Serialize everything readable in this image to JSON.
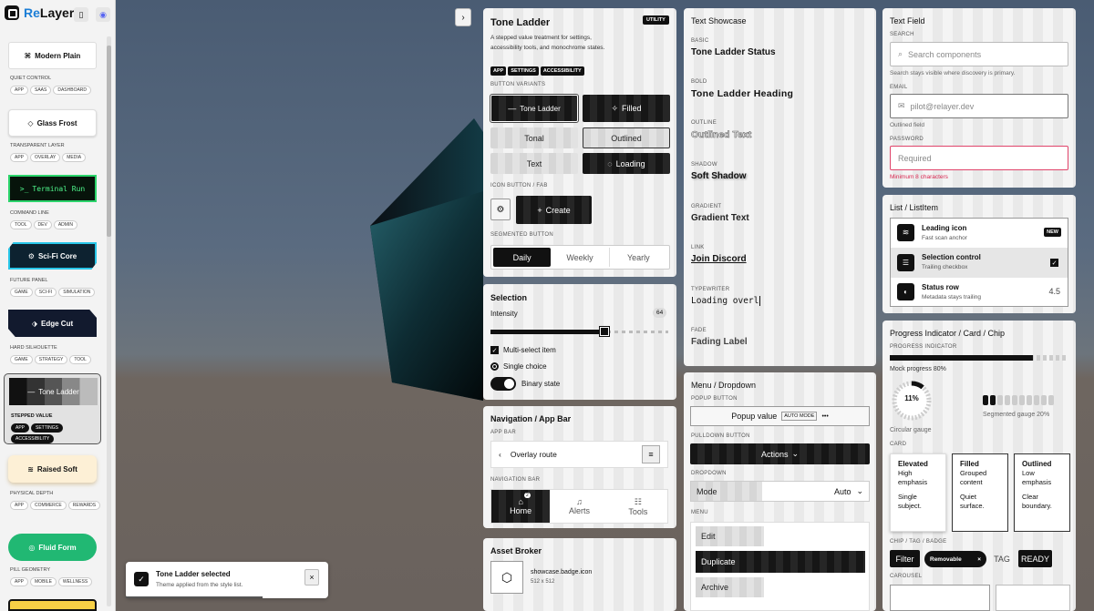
{
  "app": {
    "brand_re": "Re",
    "brand_layer": "Layer"
  },
  "sidebar": {
    "cards": [
      {
        "label": "Modern Plain",
        "caption": "QUIET CONTROL",
        "tags": [
          "APP",
          "SAAS",
          "DASHBOARD"
        ]
      },
      {
        "label": "Glass Frost",
        "caption": "TRANSPARENT LAYER",
        "tags": [
          "APP",
          "OVERLAY",
          "MEDIA"
        ]
      },
      {
        "label": "Terminal Run",
        "caption": "COMMAND LINE",
        "tags": [
          "TOOL",
          "DEV",
          "ADMIN"
        ]
      },
      {
        "label": "Sci-Fi Core",
        "caption": "FUTURE PANEL",
        "tags": [
          "GAME",
          "SCI-FI",
          "SIMULATION"
        ]
      },
      {
        "label": "Edge Cut",
        "caption": "HARD SILHOUETTE",
        "tags": [
          "GAME",
          "STRATEGY",
          "TOOL"
        ]
      },
      {
        "label": "Tone Ladder",
        "caption": "STEPPED VALUE",
        "tags": [
          "APP",
          "SETTINGS",
          "ACCESSIBILITY"
        ]
      },
      {
        "label": "Raised Soft",
        "caption": "PHYSICAL DEPTH",
        "tags": [
          "APP",
          "COMMERCE",
          "REWARDS"
        ]
      },
      {
        "label": "Fluid Form",
        "caption": "PILL GEOMETRY",
        "tags": [
          "APP",
          "MOBILE",
          "WELLNESS"
        ]
      }
    ]
  },
  "toast": {
    "title": "Tone Ladder selected",
    "body": "Theme applied from the style list.",
    "close": "×"
  },
  "tone": {
    "title": "Tone Ladder",
    "badge": "UTILITY",
    "desc1": "A stepped value treatment for settings,",
    "desc2": "accessibility tools, and monochrome states.",
    "tags": [
      "APP",
      "SETTINGS",
      "ACCESSIBILITY"
    ],
    "variants_label": "BUTTON VARIANTS",
    "b1": "Tone Ladder",
    "b2": "Filled",
    "b3": "Tonal",
    "b4": "Outlined",
    "b5": "Text",
    "b6": "Loading",
    "icon_label": "ICON BUTTON / FAB",
    "create": "Create",
    "seg_label": "SEGMENTED BUTTON",
    "seg": [
      "Daily",
      "Weekly",
      "Yearly"
    ]
  },
  "selection": {
    "title": "Selection",
    "intensity": "Intensity",
    "intensity_val": "64",
    "intensity_frac": 0.64,
    "multi": "Multi-select item",
    "single": "Single choice",
    "binary": "Binary state"
  },
  "nav": {
    "title": "Navigation / App Bar",
    "appbar_label": "APP BAR",
    "route": "Overlay route",
    "navbar_label": "NAVIGATION BAR",
    "home": "Home",
    "home_badge": "2",
    "alerts": "Alerts",
    "tools": "Tools"
  },
  "asset": {
    "title": "Asset Broker",
    "name": "showcase.badge.icon",
    "size": "512 x 512"
  },
  "text": {
    "title": "Text Showcase",
    "items": [
      {
        "label": "BASIC",
        "value": "Tone Ladder Status"
      },
      {
        "label": "BOLD",
        "value": "Tone Ladder Heading"
      },
      {
        "label": "OUTLINE",
        "value": "Outlined Text"
      },
      {
        "label": "SHADOW",
        "value": "Soft Shadow"
      },
      {
        "label": "GRADIENT",
        "value": "Gradient Text"
      },
      {
        "label": "LINK",
        "value": "Join Discord"
      },
      {
        "label": "TYPEWRITER",
        "value": "Loading overl"
      },
      {
        "label": "FADE",
        "value": "Fading Label"
      }
    ]
  },
  "menu": {
    "title": "Menu / Dropdown",
    "popup_label": "POPUP BUTTON",
    "popup": "Popup value",
    "auto": "AUTO MODE",
    "more": "•••",
    "pull_label": "PULLDOWN BUTTON",
    "actions": "Actions",
    "drop_label": "DROPDOWN",
    "mode": "Mode",
    "mode_val": "Auto",
    "menu_label": "MENU",
    "items": [
      "Edit",
      "Duplicate",
      "Archive"
    ]
  },
  "textfield": {
    "title": "Text Field",
    "search_label": "SEARCH",
    "search_ph": "Search components",
    "search_help": "Search stays visible where discovery is primary.",
    "email_label": "EMAIL",
    "email": "pilot@relayer.dev",
    "email_help": "Outlined field",
    "pw_label": "PASSWORD",
    "pw_ph": "Required",
    "pw_err": "Minimum 8 characters"
  },
  "list": {
    "title": "List / ListItem",
    "items": [
      {
        "title": "Leading icon",
        "sub": "Fast scan anchor",
        "trail": "NEW"
      },
      {
        "title": "Selection control",
        "sub": "Trailing checkbox",
        "trail": ""
      },
      {
        "title": "Status row",
        "sub": "Metadata stays trailing",
        "trail": "4.5"
      }
    ]
  },
  "progress": {
    "title": "Progress Indicator / Card / Chip",
    "pi_label": "PROGRESS INDICATOR",
    "mock": "Mock progress 80%",
    "mock_frac": 0.8,
    "circle_val": "11%",
    "circle_frac": 0.11,
    "circle_label": "Circular gauge",
    "seg_label": "Segmented gauge 20%",
    "seg_frac": 0.2,
    "card_label": "CARD",
    "cards": [
      {
        "t": "Elevated",
        "a": "High",
        "b": "emphasis",
        "c": "Single",
        "d": "subject."
      },
      {
        "t": "Filled",
        "a": "Grouped",
        "b": "content",
        "c": "Quiet",
        "d": "surface."
      },
      {
        "t": "Outlined",
        "a": "Low",
        "b": "emphasis",
        "c": "Clear",
        "d": "boundary."
      }
    ],
    "chip_label": "CHIP / TAG / BADGE",
    "filter": "Filter",
    "removable": "Removable",
    "x": "×",
    "tag": "TAG",
    "ready": "READY",
    "carousel_label": "CAROUSEL"
  }
}
